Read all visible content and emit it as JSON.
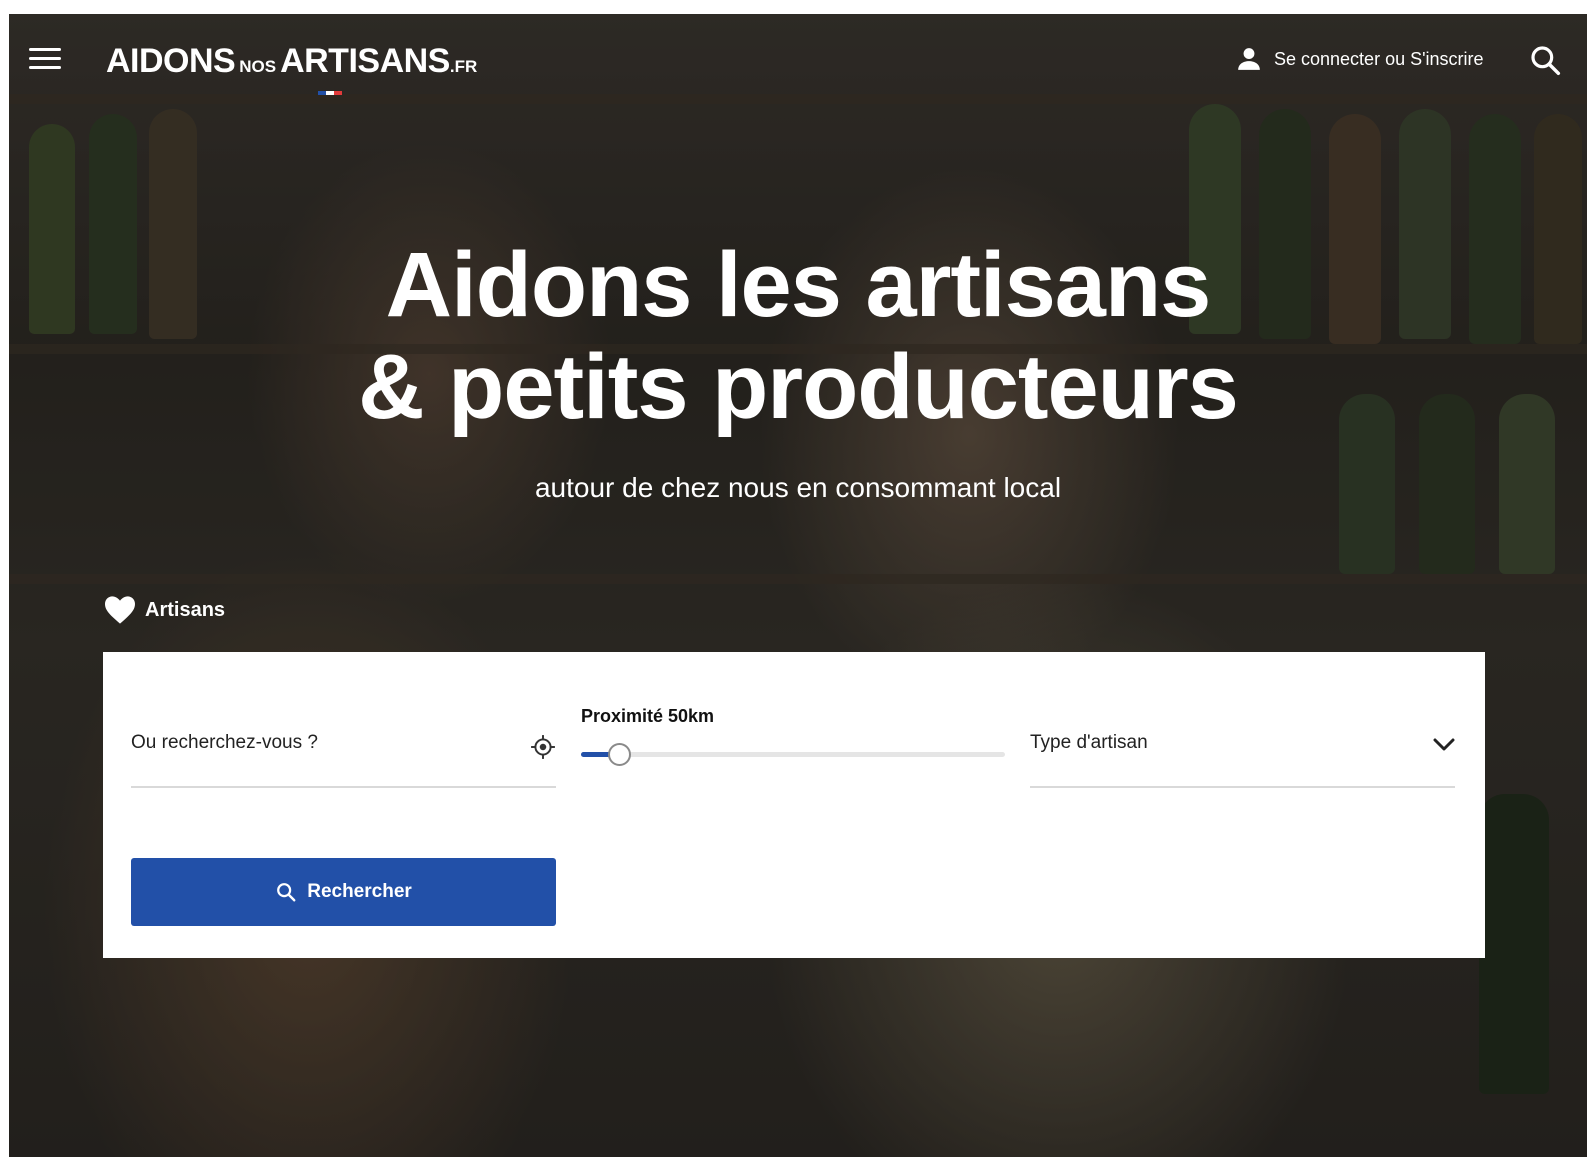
{
  "header": {
    "logo_big_1": "AIDONS",
    "logo_small": "NOS",
    "logo_big_2": "ARTISANS",
    "logo_tld": ".FR",
    "login_label": "Se connecter ou S'inscrire",
    "flag_colors": [
      "#2250a8",
      "#ffffff",
      "#e23b3b"
    ]
  },
  "hero": {
    "title_line1": "Aidons les artisans",
    "title_line2": "& petits producteurs",
    "subtitle": "autour de chez nous en consommant local"
  },
  "tab": {
    "label": "Artisans",
    "icon": "heart-icon"
  },
  "search_form": {
    "location_placeholder": "Ou recherchez-vous ?",
    "proximity_label": "Proximité 50km",
    "proximity_fraction": 0.09,
    "type_placeholder": "Type d'artisan",
    "submit_label": "Rechercher"
  },
  "colors": {
    "accent": "#2250a8",
    "card": "#ffffff",
    "text": "#222222"
  }
}
